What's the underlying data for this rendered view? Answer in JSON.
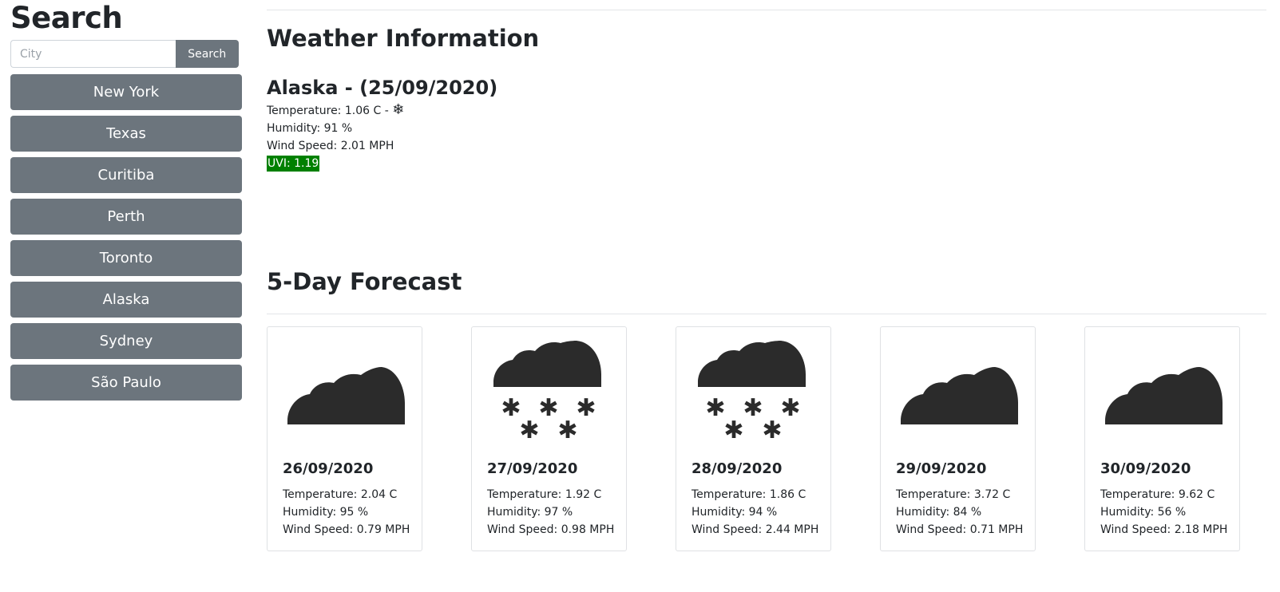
{
  "sidebar": {
    "title": "Search",
    "search_placeholder": "City",
    "search_button": "Search",
    "cities": [
      "New York",
      "Texas",
      "Curitiba",
      "Perth",
      "Toronto",
      "Alaska",
      "Sydney",
      "São Paulo"
    ]
  },
  "weather": {
    "section_title": "Weather Information",
    "city_date": "Alaska - (25/09/2020)",
    "temperature": "Temperature: 1.06 C - ",
    "condition_icon": "snowflake-icon",
    "humidity": "Humidity: 91 %",
    "wind": "Wind Speed: 2.01 MPH",
    "uvi": "UVI: 1.19",
    "uvi_color": "#008000"
  },
  "forecast": {
    "section_title": "5-Day Forecast",
    "days": [
      {
        "date": "26/09/2020",
        "temp": "Temperature: 2.04 C",
        "humidity": "Humidity: 95 %",
        "wind": "Wind Speed: 0.79 MPH",
        "icon": "cloud-icon"
      },
      {
        "date": "27/09/2020",
        "temp": "Temperature: 1.92 C",
        "humidity": "Humidity: 97 %",
        "wind": "Wind Speed: 0.98 MPH",
        "icon": "snow-cloud-icon"
      },
      {
        "date": "28/09/2020",
        "temp": "Temperature: 1.86 C",
        "humidity": "Humidity: 94 %",
        "wind": "Wind Speed: 2.44 MPH",
        "icon": "snow-cloud-icon"
      },
      {
        "date": "29/09/2020",
        "temp": "Temperature: 3.72 C",
        "humidity": "Humidity: 84 %",
        "wind": "Wind Speed: 0.71 MPH",
        "icon": "cloud-icon"
      },
      {
        "date": "30/09/2020",
        "temp": "Temperature: 9.62 C",
        "humidity": "Humidity: 56 %",
        "wind": "Wind Speed: 2.18 MPH",
        "icon": "cloud-icon"
      }
    ]
  },
  "colors": {
    "button_gray": "#6c757d",
    "uvi_green": "#008000",
    "icon_dark": "#2b2b2b"
  }
}
